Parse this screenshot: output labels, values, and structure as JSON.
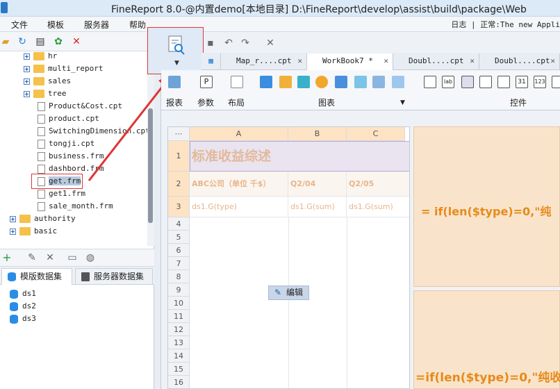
{
  "window": {
    "title": "FineReport 8.0-@内置demo[本地目录]    D:\\FineReport\\develop\\assist\\build\\package\\Web"
  },
  "menu": {
    "items": [
      "文件",
      "模板",
      "服务器",
      "帮助"
    ],
    "status": "日志 | 正常:The new  Appli"
  },
  "tree": {
    "items": [
      {
        "label": "hr",
        "kind": "folder"
      },
      {
        "label": "multi_report",
        "kind": "folder"
      },
      {
        "label": "sales",
        "kind": "folder"
      },
      {
        "label": "tree",
        "kind": "folder"
      },
      {
        "label": "Product&Cost.cpt",
        "kind": "file"
      },
      {
        "label": "product.cpt",
        "kind": "file"
      },
      {
        "label": "SwitchingDimension.cpt",
        "kind": "file"
      },
      {
        "label": "tongji.cpt",
        "kind": "file"
      },
      {
        "label": "business.frm",
        "kind": "file"
      },
      {
        "label": "dashbord.frm",
        "kind": "file"
      },
      {
        "label": "get.frm",
        "kind": "file",
        "selected": true
      },
      {
        "label": "get1.frm",
        "kind": "file"
      },
      {
        "label": "sale_month.frm",
        "kind": "file"
      },
      {
        "label": "authority",
        "kind": "folder"
      },
      {
        "label": "basic",
        "kind": "folder"
      }
    ]
  },
  "datasets": {
    "tabs": [
      "模版数据集",
      "服务器数据集"
    ],
    "items": [
      "ds1",
      "ds2",
      "ds3"
    ]
  },
  "file_tabs": [
    "Map_r....cpt",
    "WorkBook7 *",
    "Doubl....cpt",
    "Doubl....cpt"
  ],
  "ribbon": {
    "report": "报表",
    "param": "参数",
    "layout": "布局",
    "chart": "图表",
    "widget": "控件"
  },
  "sheet": {
    "columns": [
      "A",
      "B",
      "C"
    ],
    "rows": [
      "1",
      "2",
      "3",
      "4",
      "5",
      "6",
      "7",
      "8",
      "9",
      "10",
      "11",
      "12",
      "13",
      "14",
      "15",
      "16"
    ],
    "title": "标准收益综述",
    "row2": [
      "ABC公司（单位 千$）",
      "Q2/04",
      "Q2/05"
    ],
    "row3": [
      "ds1.G(type)",
      "ds1.G(sum)",
      "ds1.G(sum)"
    ]
  },
  "edit_button": "编辑",
  "formulas": {
    "top": "=   if(len($type)=0,\"纯",
    "bottom": "=if(len($type)=0,\"纯收"
  },
  "colors": {
    "accent": "#e03434",
    "orange": "#e78a1a",
    "title_bg": "#e9e4f0"
  }
}
